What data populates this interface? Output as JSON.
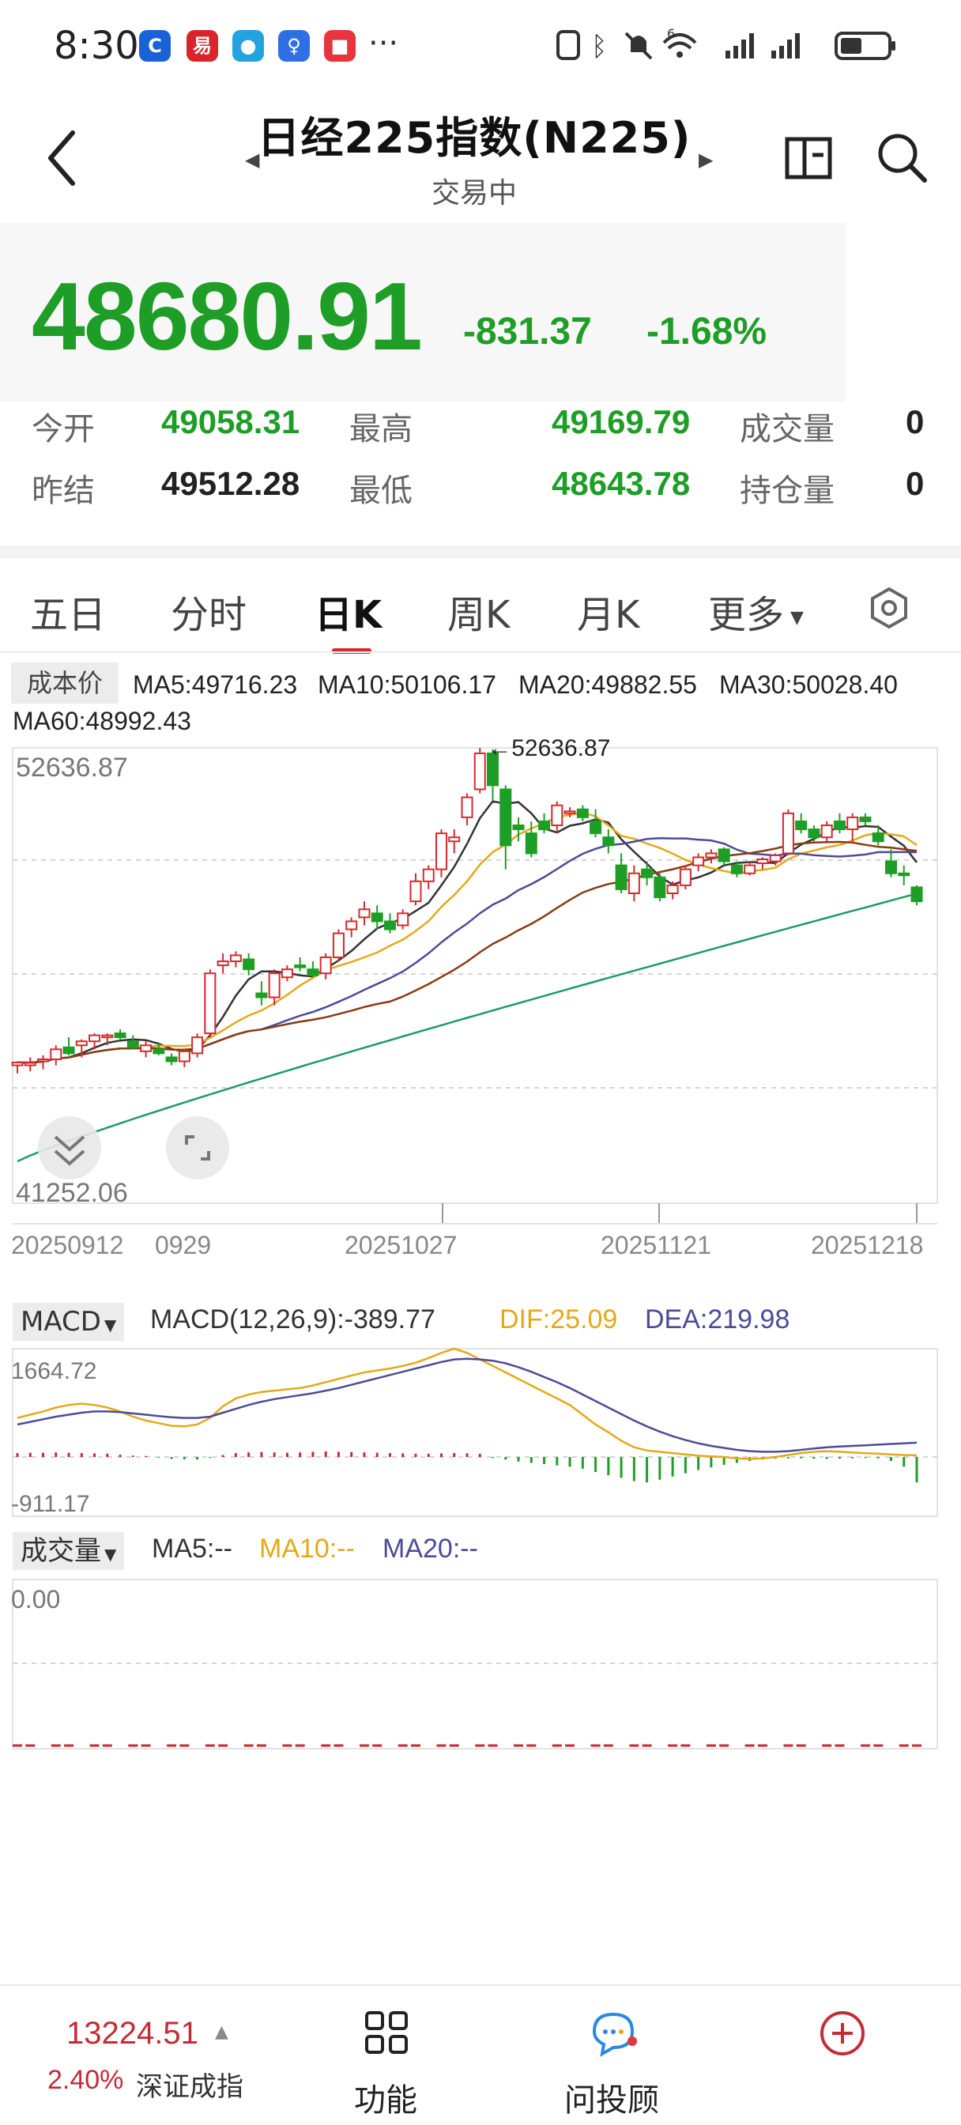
{
  "status_bar": {
    "time": "8:30",
    "more": "···",
    "signal_sup": "6",
    "apps": [
      {
        "name": "c-app-icon",
        "color": "#1a62d6",
        "glyph": "C"
      },
      {
        "name": "netease-app-icon",
        "color": "#d8252c",
        "glyph": "易"
      },
      {
        "name": "circle-app-icon",
        "color": "#22a3e0",
        "glyph": "●"
      },
      {
        "name": "bulb-app-icon",
        "color": "#2f6fe4",
        "glyph": "♀"
      },
      {
        "name": "red-app-icon",
        "color": "#e8343c",
        "glyph": "■"
      }
    ]
  },
  "header": {
    "title": "日经225指数(N225)",
    "subtitle": "交易中",
    "prev_arrow": "◀",
    "next_arrow": "▶"
  },
  "quote": {
    "price": "48680.91",
    "change": "-831.37",
    "change_pct": "-1.68%",
    "stats": [
      {
        "label": "今开",
        "value": "49058.31"
      },
      {
        "label": "最高",
        "value": "49169.79"
      },
      {
        "label": "成交量",
        "value": "0"
      },
      {
        "label": "昨结",
        "value": "49512.28"
      },
      {
        "label": "最低",
        "value": "48643.78"
      },
      {
        "label": "持仓量",
        "value": "0"
      }
    ],
    "colors": {
      "down": "#1e9e27",
      "up": "#d8282f",
      "neutral": "#222222"
    }
  },
  "tabs": {
    "items": [
      "五日",
      "分时",
      "日K",
      "周K",
      "月K",
      "更多"
    ],
    "active": "日K",
    "more_caret": "▼"
  },
  "ma_legend": {
    "cost_label": "成本价",
    "items": [
      {
        "text": "MA5:49716.23",
        "color": "#333333"
      },
      {
        "text": "MA10:50106.17",
        "color": "#e6a817"
      },
      {
        "text": "MA20:49882.55",
        "color": "#4b4b9a"
      },
      {
        "text": "MA30:50028.40",
        "color": "#8a3b12"
      },
      {
        "text": "MA60:48992.43",
        "color": "#1e9a6a"
      }
    ]
  },
  "kline": {
    "y_max_label": "52636.87",
    "y_min_label": "41252.06",
    "peak_label": "←52636.87",
    "x_labels": [
      "20250912",
      "0929",
      "20251027",
      "20251121",
      "20251218"
    ]
  },
  "macd": {
    "selector": "MACD",
    "caret": "▼",
    "summary": "MACD(12,26,9):-389.77",
    "dif": "DIF:25.09",
    "dea": "DEA:219.98",
    "y_max_label": "1664.72",
    "y_min_label": "-911.17"
  },
  "volume": {
    "selector": "成交量",
    "caret": "▼",
    "ma5": "MA5:--",
    "ma10": "MA10:--",
    "ma20": "MA20:--",
    "y_label": "0.00"
  },
  "bottom_bar": {
    "index_value": "13224.51",
    "index_arrow": "▲",
    "index_pct": "2.40%",
    "index_name": "深证成指",
    "items": [
      "功能",
      "问投顾",
      ""
    ]
  },
  "chart_data": [
    {
      "type": "candlestick",
      "title": "日K",
      "ylim": [
        41252.06,
        52636.87
      ],
      "x_tick_labels": [
        "20250912",
        "0929",
        "20251027",
        "20251121",
        "20251218"
      ],
      "ohlc": [
        [
          44700,
          44800,
          44500,
          44770
        ],
        [
          44700,
          44900,
          44550,
          44760
        ],
        [
          44800,
          44950,
          44600,
          44850
        ],
        [
          44850,
          45200,
          44700,
          45100
        ],
        [
          45150,
          45400,
          44950,
          45000
        ],
        [
          45200,
          45350,
          44900,
          45300
        ],
        [
          45300,
          45500,
          45100,
          45450
        ],
        [
          45400,
          45500,
          45200,
          45450
        ],
        [
          45500,
          45600,
          45350,
          45400
        ],
        [
          45300,
          45450,
          45100,
          45150
        ],
        [
          45050,
          45300,
          44900,
          45200
        ],
        [
          45100,
          45250,
          44950,
          45000
        ],
        [
          44900,
          45000,
          44700,
          44800
        ],
        [
          44800,
          45100,
          44650,
          45050
        ],
        [
          45000,
          45500,
          44900,
          45400
        ],
        [
          45500,
          47100,
          45400,
          47000
        ],
        [
          47200,
          47500,
          47000,
          47300
        ],
        [
          47300,
          47550,
          47150,
          47450
        ],
        [
          47350,
          47500,
          46950,
          47100
        ],
        [
          46500,
          46800,
          46200,
          46400
        ],
        [
          46400,
          47100,
          46200,
          47000
        ],
        [
          46900,
          47200,
          46800,
          47100
        ],
        [
          47200,
          47400,
          47050,
          47150
        ],
        [
          47100,
          47300,
          46900,
          46950
        ],
        [
          47000,
          47500,
          46850,
          47400
        ],
        [
          47400,
          48100,
          47300,
          48000
        ],
        [
          48100,
          48400,
          47900,
          48300
        ],
        [
          48400,
          48800,
          48200,
          48600
        ],
        [
          48500,
          48700,
          48100,
          48300
        ],
        [
          48300,
          48500,
          48000,
          48100
        ],
        [
          48200,
          48600,
          48100,
          48500
        ],
        [
          48800,
          49500,
          48700,
          49300
        ],
        [
          49300,
          49700,
          49100,
          49600
        ],
        [
          49600,
          50600,
          49400,
          50500
        ],
        [
          50300,
          50600,
          50000,
          50400
        ],
        [
          50900,
          51500,
          50700,
          51400
        ],
        [
          51600,
          52636.87,
          51500,
          52500
        ],
        [
          52500,
          52600,
          51300,
          51700
        ],
        [
          51600,
          51700,
          49600,
          50200
        ],
        [
          50700,
          50900,
          50300,
          50600
        ],
        [
          50500,
          50800,
          49900,
          50000
        ],
        [
          50800,
          51000,
          50500,
          50600
        ],
        [
          50700,
          51300,
          50500,
          51200
        ],
        [
          51000,
          51150,
          50900,
          51050
        ],
        [
          51100,
          51200,
          50800,
          50900
        ],
        [
          50800,
          51100,
          50400,
          50500
        ],
        [
          50400,
          50600,
          50000,
          50200
        ],
        [
          49700,
          50000,
          49000,
          49100
        ],
        [
          49000,
          49700,
          48800,
          49500
        ],
        [
          49600,
          49800,
          49200,
          49400
        ],
        [
          49400,
          49500,
          48800,
          48900
        ],
        [
          49000,
          49300,
          48850,
          49200
        ],
        [
          49200,
          49700,
          49100,
          49600
        ],
        [
          49700,
          50000,
          49550,
          49900
        ],
        [
          49900,
          50100,
          49750,
          50000
        ],
        [
          50100,
          50150,
          49700,
          49800
        ],
        [
          49700,
          49800,
          49400,
          49500
        ],
        [
          49500,
          49800,
          49450,
          49700
        ],
        [
          49750,
          49900,
          49600,
          49850
        ],
        [
          49800,
          50000,
          49700,
          49950
        ],
        [
          50000,
          51100,
          49950,
          51000
        ],
        [
          50800,
          51000,
          50500,
          50600
        ],
        [
          50600,
          50700,
          50300,
          50400
        ],
        [
          50400,
          50800,
          50300,
          50700
        ],
        [
          50800,
          51000,
          50500,
          50600
        ],
        [
          50600,
          51000,
          50300,
          50900
        ],
        [
          50900,
          51000,
          50700,
          50800
        ],
        [
          50500,
          50700,
          50200,
          50300
        ],
        [
          49800,
          50100,
          49400,
          49500
        ],
        [
          49500,
          49700,
          49200,
          49450
        ],
        [
          49150,
          49200,
          48700,
          48800
        ]
      ]
    },
    {
      "type": "bar",
      "title": "MACD(12,26,9)",
      "ylim": [
        -911.17,
        1664.72
      ],
      "series": [
        {
          "name": "MACD",
          "values": [
            60,
            65,
            65,
            70,
            65,
            60,
            55,
            50,
            35,
            20,
            15,
            -10,
            -30,
            -35,
            -40,
            -15,
            30,
            60,
            70,
            75,
            70,
            65,
            70,
            80,
            85,
            80,
            75,
            70,
            65,
            60,
            55,
            50,
            50,
            55,
            60,
            55,
            50,
            -15,
            -40,
            -70,
            -90,
            -110,
            -130,
            -150,
            -180,
            -230,
            -280,
            -320,
            -370,
            -389.77,
            -350,
            -300,
            -250,
            -200,
            -160,
            -120,
            -90,
            -60,
            -40,
            -25,
            -20,
            -20,
            -25,
            -30,
            -25,
            -20,
            -15,
            -20,
            -60,
            -150,
            -389.77
          ]
        },
        {
          "name": "DIF",
          "values": [
            600,
            650,
            700,
            760,
            800,
            820,
            800,
            760,
            700,
            620,
            560,
            520,
            480,
            470,
            500,
            600,
            780,
            900,
            960,
            1000,
            1020,
            1040,
            1060,
            1100,
            1150,
            1200,
            1250,
            1300,
            1330,
            1360,
            1400,
            1450,
            1520,
            1600,
            1664.72,
            1600,
            1500,
            1400,
            1300,
            1200,
            1100,
            1000,
            900,
            800,
            650,
            500,
            380,
            250,
            150,
            100,
            80,
            60,
            40,
            20,
            10,
            0,
            -20,
            -30,
            -20,
            0,
            30,
            60,
            80,
            90,
            80,
            70,
            60,
            50,
            40,
            30,
            25.09
          ]
        },
        {
          "name": "DEA",
          "values": [
            500,
            540,
            580,
            620,
            650,
            680,
            700,
            700,
            690,
            670,
            650,
            630,
            610,
            600,
            600,
            620,
            680,
            740,
            800,
            850,
            890,
            920,
            950,
            980,
            1020,
            1060,
            1110,
            1160,
            1210,
            1260,
            1310,
            1360,
            1410,
            1460,
            1500,
            1510,
            1500,
            1480,
            1440,
            1380,
            1310,
            1230,
            1150,
            1060,
            960,
            860,
            760,
            660,
            560,
            470,
            390,
            320,
            260,
            210,
            170,
            140,
            110,
            90,
            80,
            80,
            90,
            110,
            130,
            150,
            160,
            170,
            180,
            190,
            200,
            210,
            219.98
          ]
        }
      ]
    }
  ]
}
